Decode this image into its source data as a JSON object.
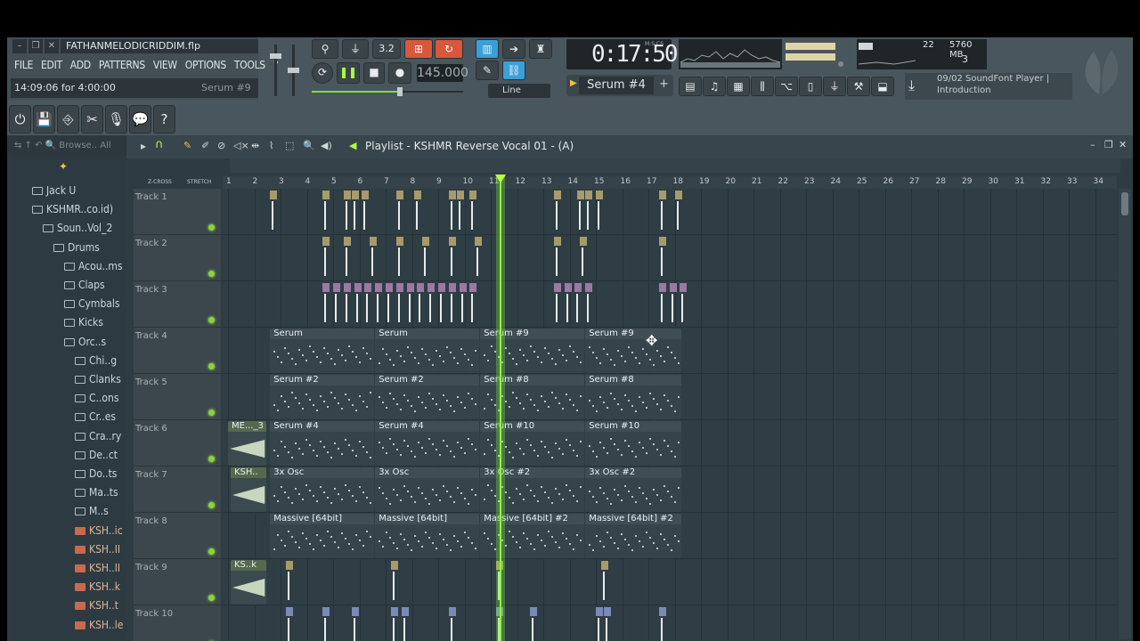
{
  "title_bar": {
    "filename": "FATHANMELODICRIDDIM.flp",
    "min": "–",
    "max": "❐",
    "close": "✕"
  },
  "menu": [
    "FILE",
    "EDIT",
    "ADD",
    "PATTERNS",
    "VIEW",
    "OPTIONS",
    "TOOLS",
    "?"
  ],
  "hint_bar": {
    "left": "14:09:06 for 4:00:00",
    "right": "Serum #9"
  },
  "transport": {
    "tempo": "145.000",
    "time": "0:17:50",
    "time_unit": "M:S:CS",
    "snap": "Line"
  },
  "cpu": {
    "value": "22",
    "memory": "5760 MB",
    "polyphony": "3"
  },
  "channel": {
    "name": "Serum #4"
  },
  "soundfont": {
    "line1": "09/02  SoundFont Player |",
    "line2": "Introduction"
  },
  "browser": {
    "header": "⇆ ↑ ↶ 🔍 Browse.. All",
    "items": [
      {
        "label": "Jack U",
        "indent": 0,
        "type": "folder"
      },
      {
        "label": "KSHMR..co.id)",
        "indent": 0,
        "type": "folder"
      },
      {
        "label": "Soun..Vol_2",
        "indent": 1,
        "type": "folder"
      },
      {
        "label": "Drums",
        "indent": 2,
        "type": "folder"
      },
      {
        "label": "Acou..ms",
        "indent": 3,
        "type": "folder"
      },
      {
        "label": "Claps",
        "indent": 3,
        "type": "folder"
      },
      {
        "label": "Cymbals",
        "indent": 3,
        "type": "folder"
      },
      {
        "label": "Kicks",
        "indent": 3,
        "type": "folder"
      },
      {
        "label": "Orc..s",
        "indent": 3,
        "type": "folder"
      },
      {
        "label": "Chi..g",
        "indent": 4,
        "type": "folder"
      },
      {
        "label": "Clanks",
        "indent": 4,
        "type": "folder"
      },
      {
        "label": "C..ons",
        "indent": 4,
        "type": "folder"
      },
      {
        "label": "Cr..es",
        "indent": 4,
        "type": "folder"
      },
      {
        "label": "Cra..ry",
        "indent": 4,
        "type": "folder"
      },
      {
        "label": "De..ct",
        "indent": 4,
        "type": "folder"
      },
      {
        "label": "Do..ts",
        "indent": 4,
        "type": "folder"
      },
      {
        "label": "Ma..ts",
        "indent": 4,
        "type": "folder"
      },
      {
        "label": "M..s",
        "indent": 4,
        "type": "folder"
      },
      {
        "label": "KSH..ic",
        "indent": 4,
        "type": "file"
      },
      {
        "label": "KSH..II",
        "indent": 4,
        "type": "file"
      },
      {
        "label": "KSH..II",
        "indent": 4,
        "type": "file"
      },
      {
        "label": "KSH..k",
        "indent": 4,
        "type": "file"
      },
      {
        "label": "KSH..t",
        "indent": 4,
        "type": "file"
      },
      {
        "label": "KSH..le",
        "indent": 4,
        "type": "file"
      }
    ]
  },
  "playlist": {
    "title": "Playlist - KSHMR Reverse Vocal 01 - (A)",
    "zcross": "Z-CROSS",
    "stretch": "STRETCH",
    "bars": [
      "1",
      "2",
      "3",
      "4",
      "5",
      "6",
      "7",
      "8",
      "9",
      "10",
      "11",
      "12",
      "13",
      "14",
      "15",
      "16",
      "17",
      "18",
      "19",
      "20",
      "21",
      "22",
      "23",
      "24",
      "25",
      "26",
      "27",
      "28",
      "29",
      "30",
      "31",
      "32",
      "33",
      "34"
    ],
    "tracks": [
      "Track 1",
      "Track 2",
      "Track 3",
      "Track 4",
      "Track 5",
      "Track 6",
      "Track 7",
      "Track 8",
      "Track 9",
      "Track 10"
    ],
    "playhead_bar": 11.35,
    "clips": [
      {
        "track": 4,
        "start": 2.6,
        "end": 6.6,
        "label": "Serum",
        "kind": "pattern"
      },
      {
        "track": 4,
        "start": 6.6,
        "end": 10.6,
        "label": "Serum",
        "kind": "pattern"
      },
      {
        "track": 4,
        "start": 10.6,
        "end": 14.6,
        "label": "Serum #9",
        "kind": "pattern"
      },
      {
        "track": 4,
        "start": 14.6,
        "end": 18.3,
        "label": "Serum #9",
        "kind": "pattern"
      },
      {
        "track": 5,
        "start": 2.6,
        "end": 6.6,
        "label": "Serum #2",
        "kind": "pattern"
      },
      {
        "track": 5,
        "start": 6.6,
        "end": 10.6,
        "label": "Serum #2",
        "kind": "pattern"
      },
      {
        "track": 5,
        "start": 10.6,
        "end": 14.6,
        "label": "Serum #8",
        "kind": "pattern"
      },
      {
        "track": 5,
        "start": 14.6,
        "end": 18.3,
        "label": "Serum #8",
        "kind": "pattern"
      },
      {
        "track": 6,
        "start": 1.0,
        "end": 2.5,
        "label": "ME..._3",
        "kind": "audio"
      },
      {
        "track": 6,
        "start": 2.6,
        "end": 6.6,
        "label": "Serum #4",
        "kind": "pattern"
      },
      {
        "track": 6,
        "start": 6.6,
        "end": 10.6,
        "label": "Serum #4",
        "kind": "pattern"
      },
      {
        "track": 6,
        "start": 10.6,
        "end": 14.6,
        "label": "Serum #10",
        "kind": "pattern"
      },
      {
        "track": 6,
        "start": 14.6,
        "end": 18.3,
        "label": "Serum #10",
        "kind": "pattern"
      },
      {
        "track": 7,
        "start": 1.1,
        "end": 2.5,
        "label": "KSH..",
        "kind": "audio"
      },
      {
        "track": 7,
        "start": 2.6,
        "end": 6.6,
        "label": "3x Osc",
        "kind": "pattern"
      },
      {
        "track": 7,
        "start": 6.6,
        "end": 10.6,
        "label": "3x Osc",
        "kind": "pattern"
      },
      {
        "track": 7,
        "start": 10.6,
        "end": 14.6,
        "label": "3x Osc #2",
        "kind": "pattern"
      },
      {
        "track": 7,
        "start": 14.6,
        "end": 18.3,
        "label": "3x Osc #2",
        "kind": "pattern"
      },
      {
        "track": 8,
        "start": 2.6,
        "end": 6.6,
        "label": "Massive [64bit]",
        "kind": "pattern"
      },
      {
        "track": 8,
        "start": 6.6,
        "end": 10.6,
        "label": "Massive [64bit]",
        "kind": "pattern"
      },
      {
        "track": 8,
        "start": 10.6,
        "end": 14.6,
        "label": "Massive [64bit] #2",
        "kind": "pattern"
      },
      {
        "track": 8,
        "start": 14.6,
        "end": 18.3,
        "label": "Massive [64bit] #2",
        "kind": "pattern"
      },
      {
        "track": 9,
        "start": 1.1,
        "end": 2.5,
        "label": "KS..k",
        "kind": "audio"
      }
    ],
    "hits": {
      "1": [
        2.6,
        4.6,
        5.4,
        5.7,
        6.1,
        7.4,
        8.1,
        9.4,
        9.7,
        10.2,
        13.4,
        14.3,
        14.6,
        15.0,
        17.4,
        18.0
      ],
      "2": [
        4.6,
        5.4,
        6.4,
        7.4,
        8.4,
        9.4,
        10.4,
        13.4,
        14.4,
        17.4
      ],
      "3": [
        4.6,
        5.0,
        5.4,
        5.8,
        6.2,
        6.6,
        7.0,
        7.4,
        7.8,
        8.2,
        8.6,
        9.0,
        9.4,
        9.8,
        10.2,
        13.4,
        13.8,
        14.2,
        14.6,
        17.4,
        17.8,
        18.2
      ],
      "9": [
        3.2,
        7.2,
        11.2,
        15.2
      ],
      "10": [
        3.2,
        4.6,
        5.7,
        7.2,
        7.6,
        9.4,
        11.2,
        12.5,
        15.0,
        15.3,
        17.4
      ]
    }
  },
  "colors": {
    "accent_green": "#96f040",
    "clip_header": "#56694f",
    "bg": "#2f3d44"
  }
}
